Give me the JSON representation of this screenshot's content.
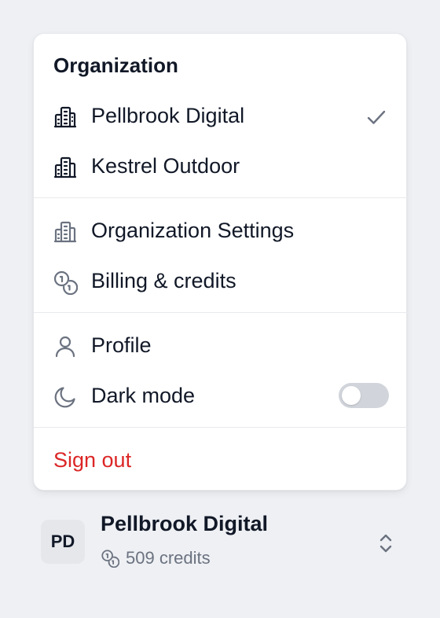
{
  "menu": {
    "heading": "Organization",
    "orgs": [
      {
        "label": "Pellbrook Digital",
        "selected": true,
        "icon": "building-icon"
      },
      {
        "label": "Kestrel Outdoor",
        "selected": false,
        "icon": "building-icon"
      }
    ],
    "org_settings_label": "Organization Settings",
    "billing_label": "Billing & credits",
    "profile_label": "Profile",
    "dark_mode_label": "Dark mode",
    "dark_mode_on": false,
    "sign_out_label": "Sign out"
  },
  "switcher": {
    "avatar_initials": "PD",
    "org_name": "Pellbrook Digital",
    "credits_text": "509 credits"
  },
  "colors": {
    "danger": "#dc2626",
    "text": "#111827",
    "muted": "#6b7280",
    "toggle_off": "#d1d5db",
    "background": "#eef0f3"
  }
}
